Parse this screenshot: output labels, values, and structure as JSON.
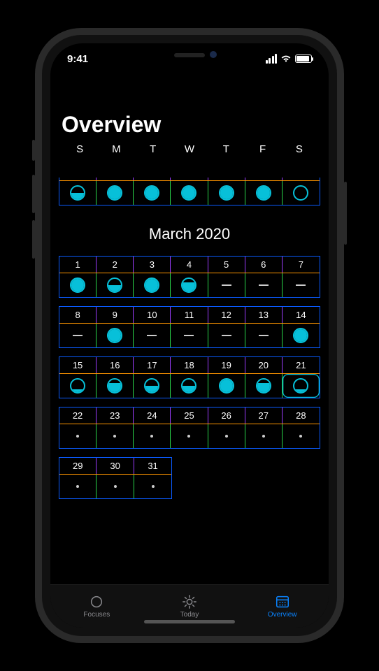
{
  "status": {
    "time": "9:41"
  },
  "header": {
    "title": "Overview"
  },
  "weekdays": [
    "S",
    "M",
    "T",
    "W",
    "T",
    "F",
    "S"
  ],
  "month": {
    "label": "March 2020"
  },
  "prev_partial": {
    "indicators": [
      "f50",
      "f100",
      "f100",
      "f100",
      "f100",
      "f100",
      "f0"
    ]
  },
  "weeks": [
    {
      "days": [
        "1",
        "2",
        "3",
        "4",
        "5",
        "6",
        "7"
      ],
      "ind": [
        "f100",
        "f50",
        "f100",
        "f75",
        "dash",
        "dash",
        "dash"
      ]
    },
    {
      "days": [
        "8",
        "9",
        "10",
        "11",
        "12",
        "13",
        "14"
      ],
      "ind": [
        "dash",
        "f100",
        "dash",
        "dash",
        "dash",
        "dash",
        "f100"
      ]
    },
    {
      "days": [
        "15",
        "16",
        "17",
        "18",
        "19",
        "20",
        "21"
      ],
      "ind": [
        "f25",
        "f75",
        "f50",
        "f50",
        "f100",
        "f75",
        "f25"
      ],
      "today_index": 6
    },
    {
      "days": [
        "22",
        "23",
        "24",
        "25",
        "26",
        "27",
        "28"
      ],
      "ind": [
        "dot",
        "dot",
        "dot",
        "dot",
        "dot",
        "dot",
        "dot"
      ]
    }
  ],
  "tail": {
    "days": [
      "29",
      "30",
      "31"
    ],
    "ind": [
      "dot",
      "dot",
      "dot"
    ]
  },
  "tabs": {
    "focuses": "Focuses",
    "today": "Today",
    "overview": "Overview"
  }
}
